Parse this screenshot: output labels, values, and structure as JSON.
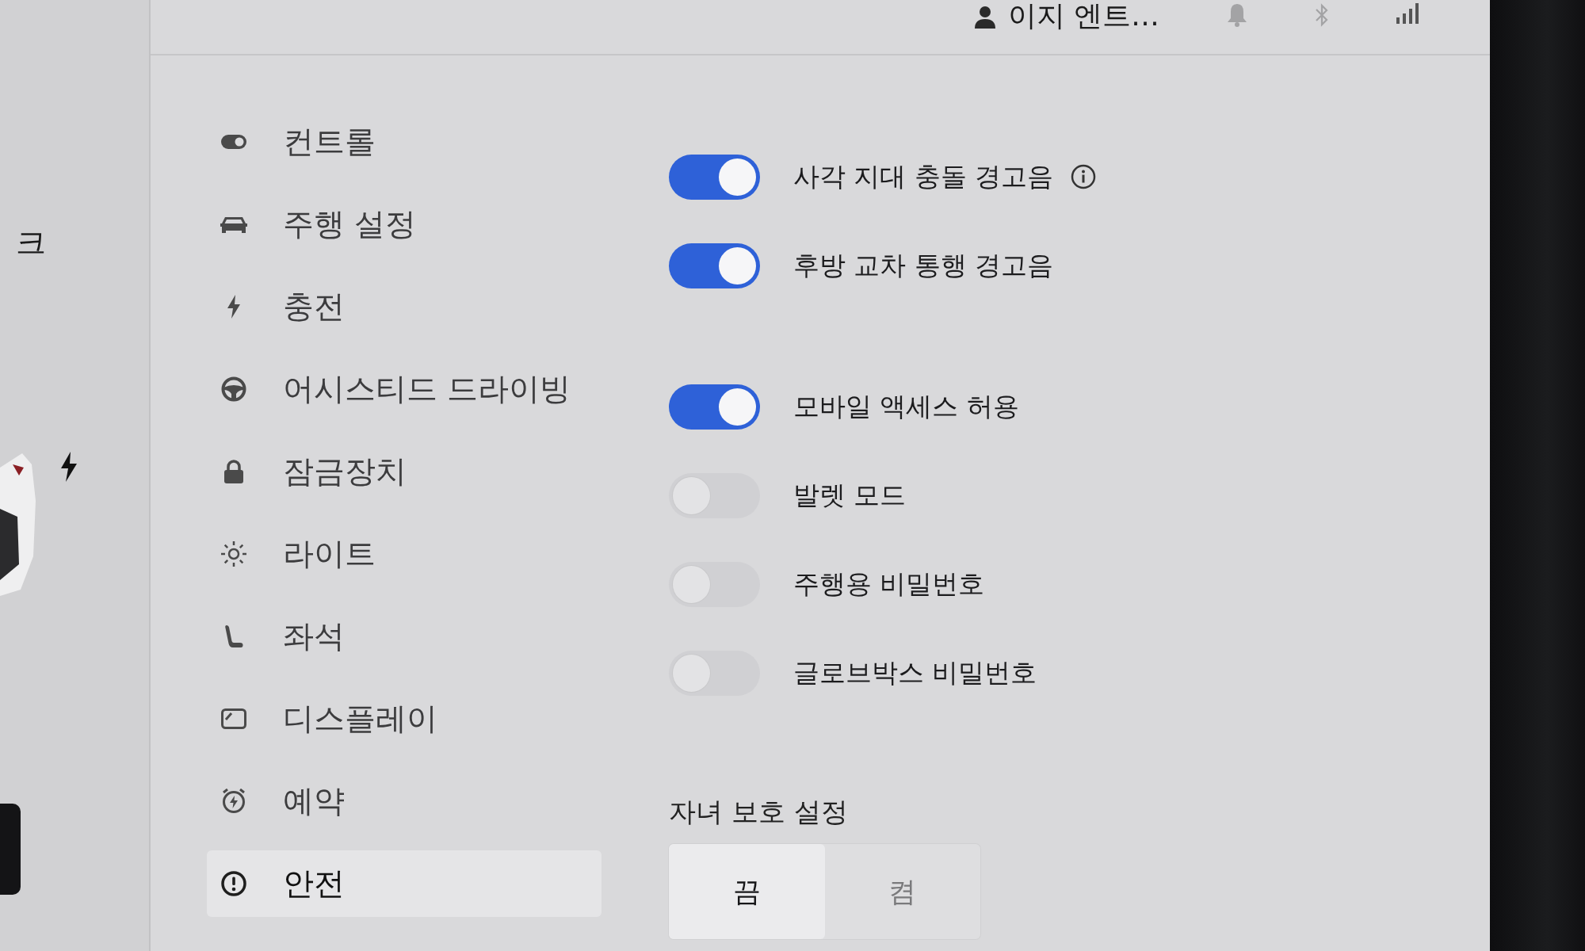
{
  "left_panel": {
    "label": "크"
  },
  "top_bar": {
    "profile_name": "이지 엔트…"
  },
  "menu": {
    "items": [
      {
        "label": "컨트롤",
        "selected": false
      },
      {
        "label": "주행 설정",
        "selected": false
      },
      {
        "label": "충전",
        "selected": false
      },
      {
        "label": "어시스티드 드라이빙",
        "selected": false
      },
      {
        "label": "잠금장치",
        "selected": false
      },
      {
        "label": "라이트",
        "selected": false
      },
      {
        "label": "좌석",
        "selected": false
      },
      {
        "label": "디스플레이",
        "selected": false
      },
      {
        "label": "예약",
        "selected": false
      },
      {
        "label": "안전",
        "selected": true
      }
    ]
  },
  "settings": {
    "groups": [
      {
        "toggles": [
          {
            "label": "사각 지대 충돌 경고음",
            "on": true,
            "info": true
          },
          {
            "label": "후방 교차 통행 경고음",
            "on": true,
            "info": false
          }
        ]
      },
      {
        "toggles": [
          {
            "label": "모바일 액세스 허용",
            "on": true,
            "info": false
          },
          {
            "label": "발렛 모드",
            "on": false,
            "info": false
          },
          {
            "label": "주행용 비밀번호",
            "on": false,
            "info": false
          },
          {
            "label": "글로브박스 비밀번호",
            "on": false,
            "info": false
          }
        ]
      }
    ]
  },
  "child_protection": {
    "title": "자녀 보호 설정",
    "options": [
      {
        "label": "끔",
        "selected": true
      },
      {
        "label": "켬",
        "selected": false
      }
    ]
  }
}
